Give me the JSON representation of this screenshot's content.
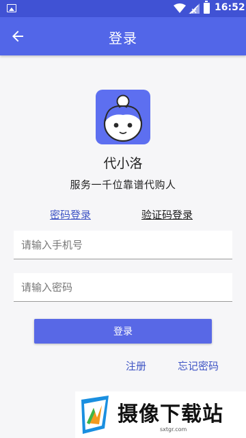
{
  "status_bar": {
    "time": "16:52"
  },
  "app_bar": {
    "title": "登录"
  },
  "app": {
    "name": "代小洛",
    "slogan": "服务一千位靠谱代购人"
  },
  "tabs": [
    {
      "label": "密码登录"
    },
    {
      "label": "验证码登录"
    }
  ],
  "form": {
    "phone_placeholder": "请输入手机号",
    "phone_value": "",
    "password_placeholder": "请输入密码",
    "password_value": "",
    "login_label": "登录"
  },
  "links": {
    "register": "注册",
    "forgot": "忘记密码"
  },
  "watermark": {
    "text": "摄像下载站",
    "url": "sxtgr.com"
  },
  "colors": {
    "status_bar": "#4052d4",
    "app_bar": "#5266e8",
    "accent": "#5868e6",
    "link": "#3d53c4"
  }
}
